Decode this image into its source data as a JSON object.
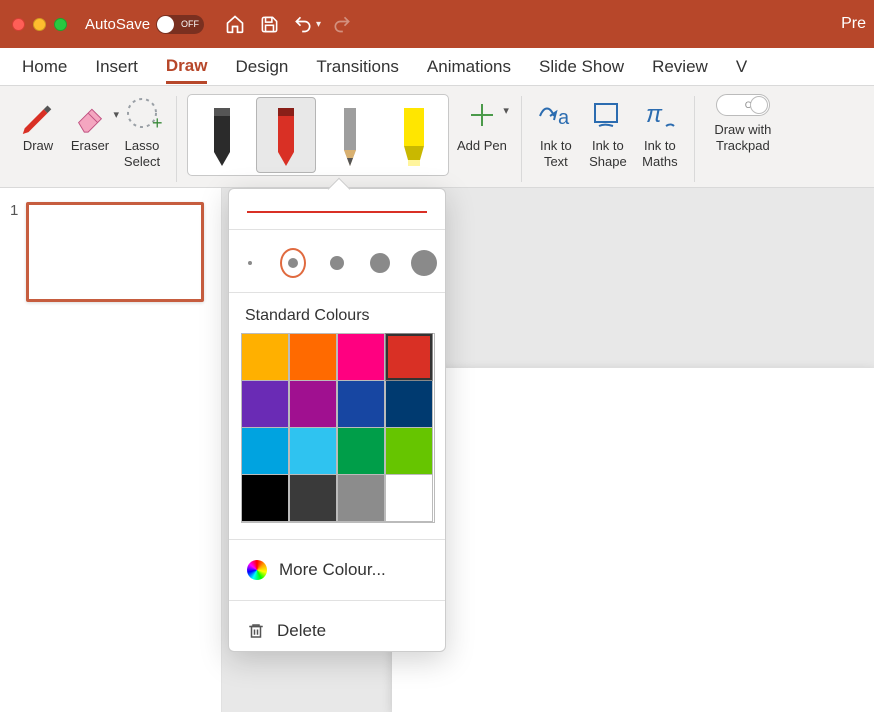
{
  "titlebar": {
    "autosave_label": "AutoSave",
    "autosave_state": "OFF",
    "app_name_fragment": "Pre"
  },
  "tabs": {
    "items": [
      "Home",
      "Insert",
      "Draw",
      "Design",
      "Transitions",
      "Animations",
      "Slide Show",
      "Review",
      "V"
    ],
    "active_index": 2
  },
  "ribbon": {
    "draw_label": "Draw",
    "eraser_label": "Eraser",
    "lasso_label": "Lasso\nSelect",
    "add_pen_label": "Add Pen",
    "ink_to_text_label": "Ink to\nText",
    "ink_to_shape_label": "Ink to\nShape",
    "ink_to_maths_label": "Ink to\nMaths",
    "draw_trackpad_label": "Draw with\nTrackpad",
    "trackpad_state": "OFF",
    "pens": [
      {
        "name": "pen-black",
        "color": "#2b2b2b",
        "type": "pen"
      },
      {
        "name": "pen-red",
        "color": "#d93025",
        "type": "pen",
        "selected": true
      },
      {
        "name": "pencil-gray",
        "color": "#9e9e9e",
        "type": "pencil"
      },
      {
        "name": "highlighter-yellow",
        "color": "#ffe600",
        "type": "highlighter"
      }
    ]
  },
  "popup": {
    "preview_color": "#d93025",
    "thickness_options": [
      4,
      10,
      14,
      20,
      26
    ],
    "thickness_selected_index": 1,
    "standard_colours_label": "Standard Colours",
    "colours": [
      "#ffb000",
      "#ff6a00",
      "#ff0080",
      "#d93025",
      "#6a2bb5",
      "#a01090",
      "#1746a2",
      "#003a70",
      "#00a3e0",
      "#2fc3f0",
      "#009e49",
      "#66c500",
      "#000000",
      "#3a3a3a",
      "#8c8c8c",
      "#ffffff"
    ],
    "selected_colour_index": 3,
    "more_colours_label": "More Colour...",
    "delete_label": "Delete"
  },
  "slides": {
    "items": [
      {
        "number": "1"
      }
    ]
  }
}
